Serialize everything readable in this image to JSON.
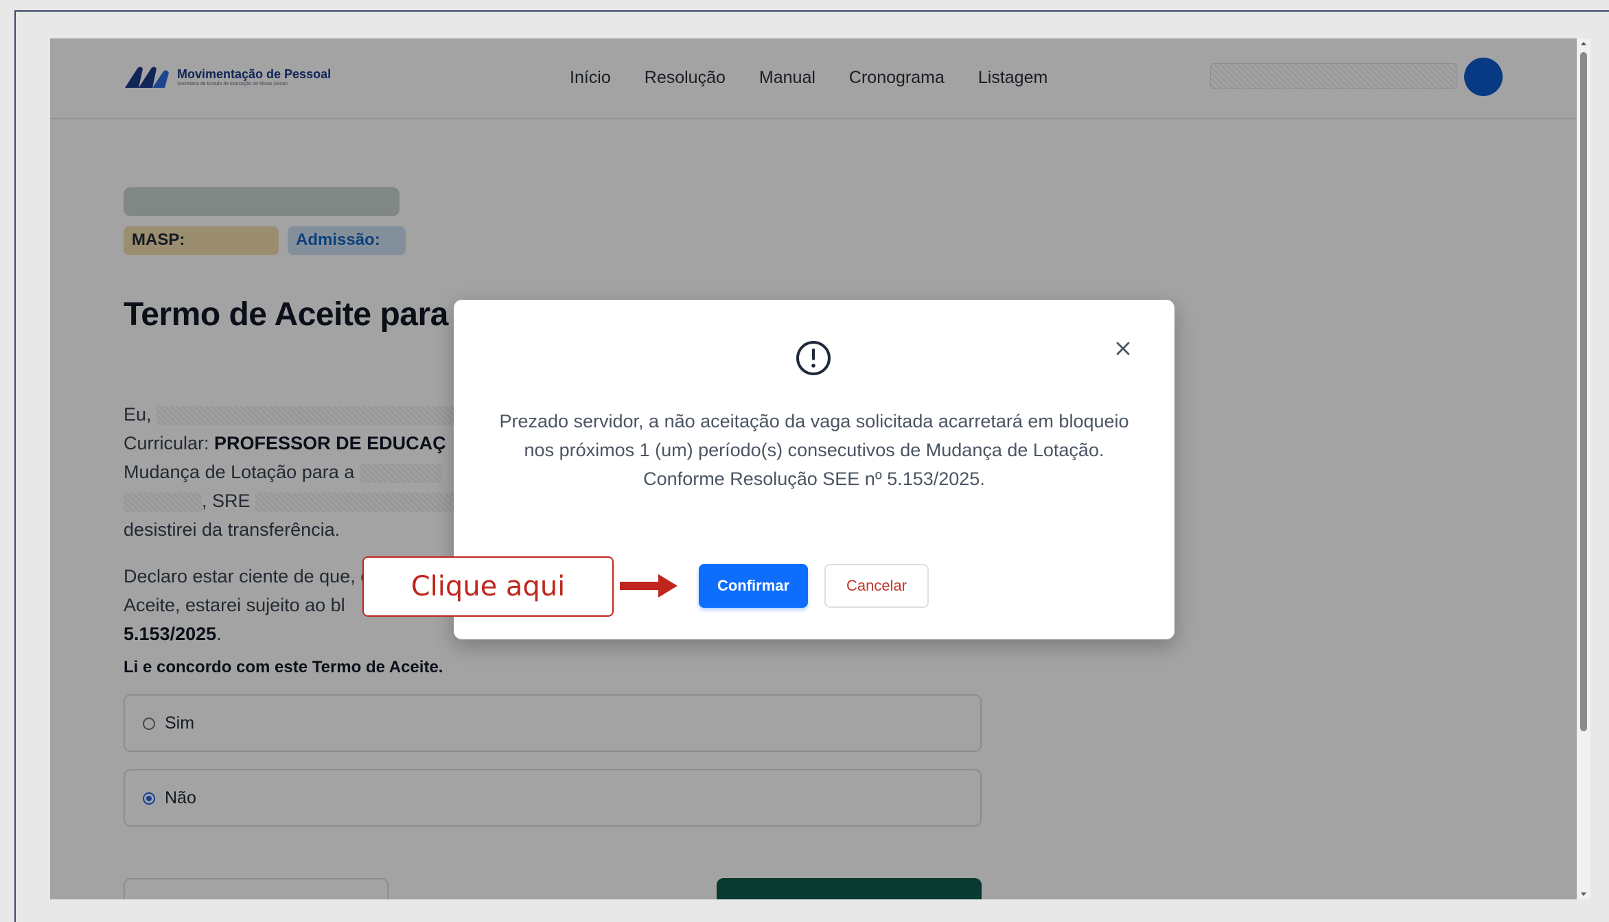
{
  "app": {
    "logo_title": "Movimentação de Pessoal",
    "logo_subtitle": "Secretaria de Estado de Educação de Minas Gerais"
  },
  "nav": {
    "items": [
      "Início",
      "Resolução",
      "Manual",
      "Cronograma",
      "Listagem"
    ]
  },
  "profile": {
    "masp_label": "MASP:",
    "admissao_label": "Admissão:"
  },
  "page": {
    "title": "Termo de Aceite para",
    "para1": {
      "line1_prefix": "Eu,",
      "line2_prefix": "Curricular:",
      "line2_bold": "PROFESSOR DE EDUCAÇ",
      "line3_prefix": "Mudança de Lotação para a",
      "line4_suffix": ", SRE",
      "line5": "desistirei da transferência."
    },
    "para2": {
      "line1": "Declaro estar ciente de que, caso eu",
      "line2": "Aceite, estarei sujeito ao bl",
      "line3_bold": "5.153/2025",
      "line3_suffix": "."
    },
    "agree_question": "Li e concordo com este Termo de Aceite.",
    "options": [
      {
        "label": "Sim",
        "selected": false
      },
      {
        "label": "Não",
        "selected": true
      }
    ]
  },
  "modal": {
    "icon": "exclamation-circle-icon",
    "message": "Prezado servidor, a não aceitação da vaga solicitada acarretará em bloqueio nos próximos 1 (um) período(s) consecutivos de Mudança de Lotação. Conforme Resolução SEE nº 5.153/2025.",
    "confirm_label": "Confirmar",
    "cancel_label": "Cancelar"
  },
  "annotation": {
    "callout_text": "Clique aqui",
    "color": "#c0261d"
  },
  "colors": {
    "primary": "#0d6efd",
    "brand": "#1b3b8a",
    "danger_text": "#c0392b"
  }
}
